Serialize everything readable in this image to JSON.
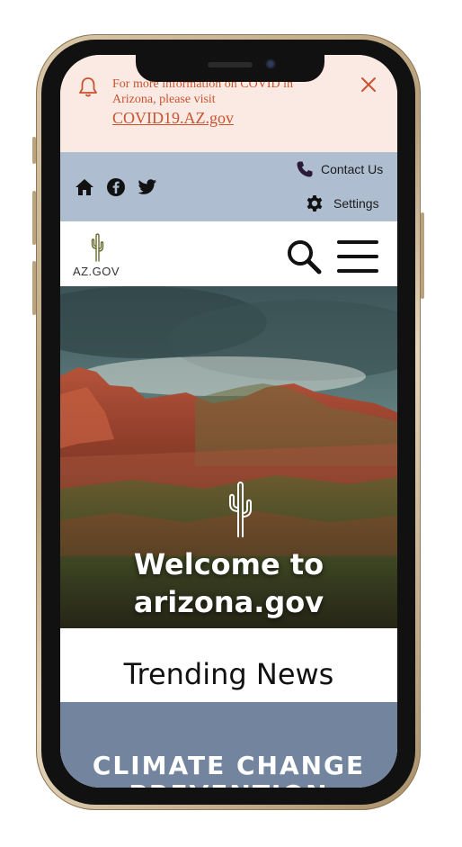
{
  "covid_banner": {
    "message": "For more information on COVID in Arizona, please visit",
    "link_text": "COVID19.AZ.gov",
    "icon": "bell-icon",
    "close_icon": "close-icon"
  },
  "utility_bar": {
    "icons": [
      "home-icon",
      "facebook-icon",
      "twitter-icon"
    ],
    "contact_label": "Contact Us",
    "settings_label": "Settings"
  },
  "header": {
    "logo_text": "AZ.GOV",
    "search_icon": "search-icon",
    "menu_icon": "hamburger-menu-icon"
  },
  "hero": {
    "welcome_line1": "Welcome to",
    "welcome_line2": "arizona.gov"
  },
  "trending": {
    "title": "Trending News"
  },
  "feature_card": {
    "title_line1": "CLIMATE CHANGE",
    "title_line2": "PREVENTION"
  },
  "colors": {
    "banner_bg": "#fbeae3",
    "banner_text": "#c8532f",
    "utility_bg": "#aebdd0",
    "card_bg": "#73859e"
  }
}
